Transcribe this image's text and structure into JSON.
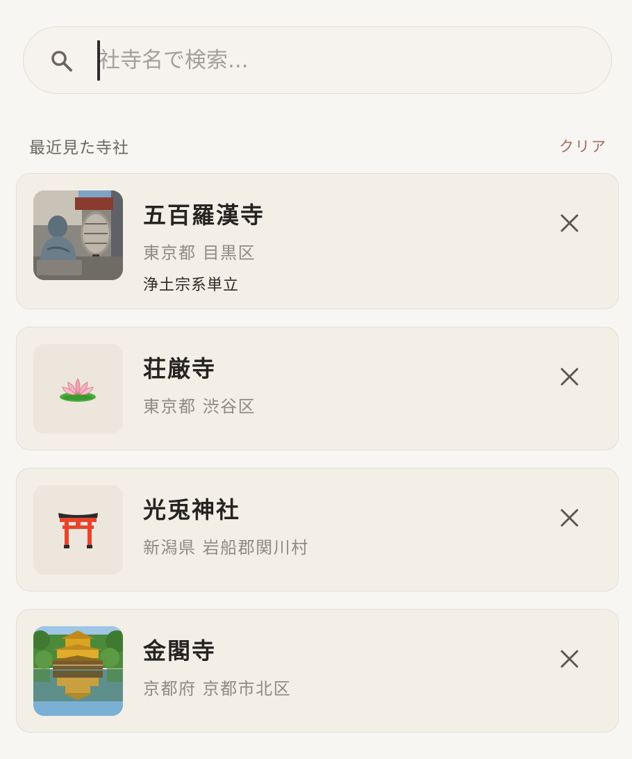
{
  "search": {
    "placeholder": "社寺名で検索..."
  },
  "recent": {
    "title": "最近見た寺社",
    "clear_label": "クリア",
    "items": [
      {
        "name": "五百羅漢寺",
        "location": "東京都 目黒区",
        "sect": "浄土宗系単立",
        "thumbnail": "statue-photo"
      },
      {
        "name": "荘厳寺",
        "location": "東京都 渋谷区",
        "thumbnail": "lotus-icon"
      },
      {
        "name": "光兎神社",
        "location": "新潟県 岩船郡関川村",
        "thumbnail": "torii-icon"
      },
      {
        "name": "金閣寺",
        "location": "京都府 京都市北区",
        "thumbnail": "kinkakuji-photo"
      }
    ]
  },
  "colors": {
    "background": "#f8f6f2",
    "card": "#f3efe7",
    "clear": "#9c6b60",
    "torii": "#e8442c"
  }
}
